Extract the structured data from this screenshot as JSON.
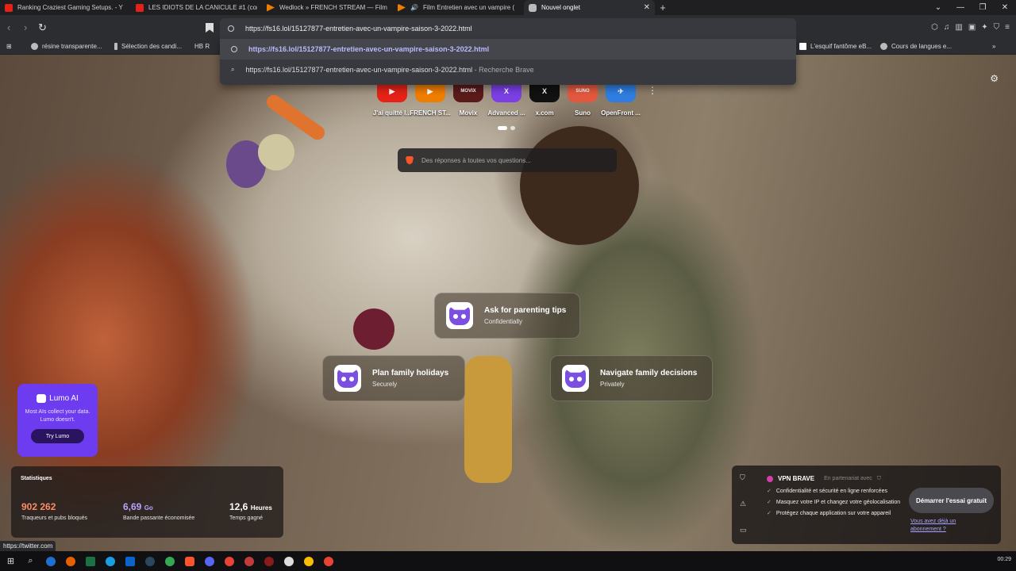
{
  "tabs": [
    {
      "title": "Ranking Craziest Gaming Setups. - Y",
      "icon": "youtube-icon",
      "color": "#e62117"
    },
    {
      "title": "LES IDIOTS DE LA CANICULE #1 (con",
      "icon": "youtube-icon",
      "color": "#e62117"
    },
    {
      "title": "Wedlock » FRENCH STREAM — Film",
      "icon": "play-icon",
      "color": "#ef7d00"
    },
    {
      "title": "Film Entretien avec un vampire (",
      "icon": "play-icon",
      "color": "#ef7d00"
    },
    {
      "title": "Nouvel onglet",
      "icon": "brave-icon",
      "color": "#bbbbbb"
    }
  ],
  "tab_close": "✕",
  "new_tab": "+",
  "omnibox": {
    "value": "https://fs16.lol/15127877-entretien-avec-un-vampire-saison-3-2022.html"
  },
  "suggestions": [
    {
      "text": "https://fs16.lol/15127877-entretien-avec-un-vampire-saison-3-2022.html",
      "suffix": ""
    },
    {
      "text": "https://fs16.lol/15127877-entretien-avec-un-vampire-saison-3-2022.html",
      "suffix": "- Recherche Brave"
    }
  ],
  "bookmarks_left": [
    "résine transparente...",
    "Sélection des candi...",
    "HB R"
  ],
  "bookmarks_right": [
    "L'esquif fantôme eB...",
    "Cours de langues e..."
  ],
  "top_sites": [
    {
      "label": "J'ai quitté l...",
      "color": "#e62117",
      "glyph": "▶"
    },
    {
      "label": "FRENCH ST...",
      "color": "#ef7d00",
      "glyph": "▶"
    },
    {
      "label": "Movix",
      "color": "#5a1a1a",
      "glyph": "MOVIX"
    },
    {
      "label": "Advanced ...",
      "color": "#7b3fe4",
      "glyph": "X"
    },
    {
      "label": "x.com",
      "color": "#111111",
      "glyph": "X"
    },
    {
      "label": "Suno",
      "color": "#e2583e",
      "glyph": "SUNO"
    },
    {
      "label": "OpenFront ...",
      "color": "#2f7de0",
      "glyph": "✈"
    }
  ],
  "search_placeholder": "Des réponses à toutes vos questions...",
  "prompt_cards": [
    {
      "title": "Ask for parenting tips",
      "subtitle": "Confidentially"
    },
    {
      "title": "Plan family holidays",
      "subtitle": "Securely"
    },
    {
      "title": "Navigate family decisions",
      "subtitle": "Privately"
    }
  ],
  "lumo": {
    "brand": "Lumo AI",
    "description": "Most AIs collect your data. Lumo doesn't.",
    "button": "Try Lumo"
  },
  "stats": {
    "heading": "Statistiques",
    "trackers": {
      "value": "902 262",
      "label": "Traqueurs et pubs bloqués",
      "color": "#ff8a65"
    },
    "bandwidth": {
      "value": "6,69",
      "unit": "Go",
      "label": "Bande passante économisée",
      "color": "#b6a4ff"
    },
    "time": {
      "value": "12,6",
      "unit": "Heures",
      "label": "Temps gagné",
      "color": "#ffffff"
    }
  },
  "vpn": {
    "title": "VPN BRAVE",
    "partner": "En partenariat avec",
    "features": [
      "Confidentialité et sécurité en ligne renforcées",
      "Masquez votre IP et changez votre géolocalisation",
      "Protégez chaque application sur votre appareil"
    ],
    "cta": "Démarrer l'essai gratuit",
    "subscribed": "Vous avez déjà un abonnement ?"
  },
  "status_url": "https://twitter.com",
  "clock": "00:29"
}
